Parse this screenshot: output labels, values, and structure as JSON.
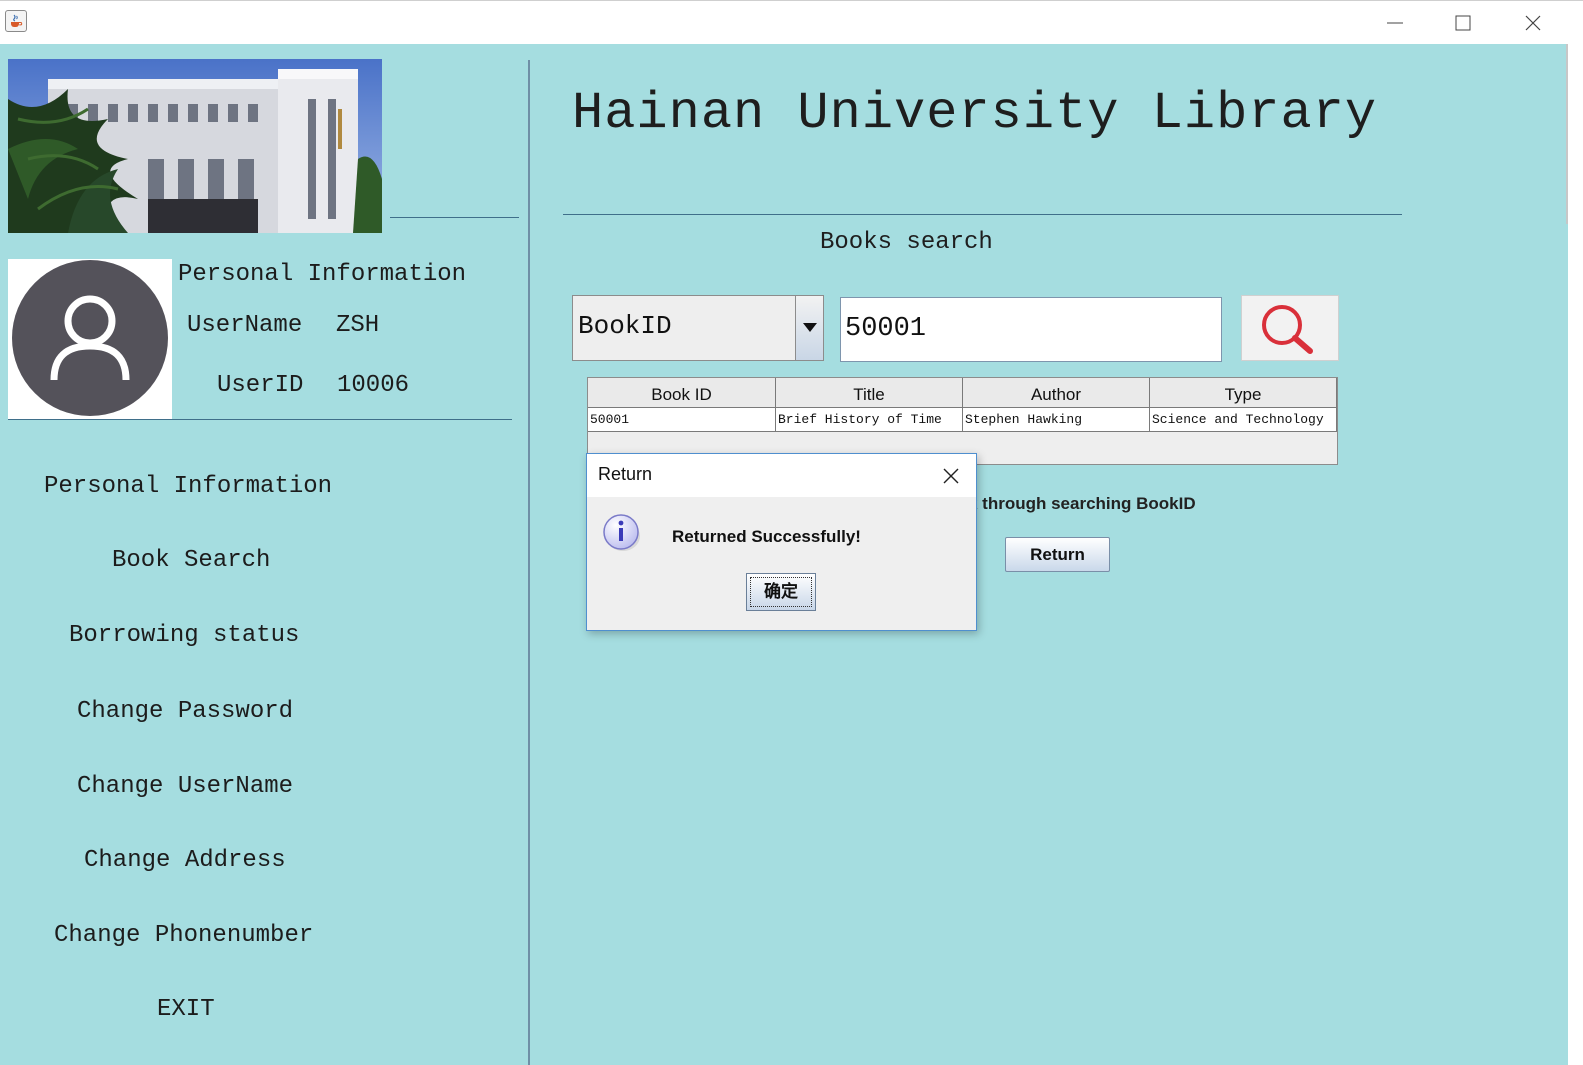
{
  "window": {
    "app_icon": "java-cup-icon",
    "controls": [
      "minimize-icon",
      "maximize-icon",
      "close-icon"
    ]
  },
  "sidebar": {
    "banner_image": "university-building-photo",
    "avatar_icon": "user-icon",
    "personal_heading": "Personal Information",
    "username_label": "UserName",
    "username_value": "ZSH",
    "userid_label": "UserID",
    "userid_value": "10006",
    "nav": [
      {
        "label": "Personal Information"
      },
      {
        "label": "Book Search"
      },
      {
        "label": "Borrowing status"
      },
      {
        "label": "Change Password"
      },
      {
        "label": "Change UserName"
      },
      {
        "label": "Change Address"
      },
      {
        "label": "Change Phonenumber"
      },
      {
        "label": "EXIT"
      }
    ]
  },
  "main": {
    "title": "Hainan University Library",
    "section_title": "Books search",
    "search": {
      "field_selected": "BookID",
      "query": "50001",
      "search_icon": "magnifier-icon"
    },
    "table": {
      "columns": [
        "Book ID",
        "Title",
        "Author",
        "Type"
      ],
      "rows": [
        [
          "50001",
          "Brief History of Time",
          "Stephen Hawking",
          "Science and Technology"
        ]
      ]
    },
    "hint_visible": "k through searching BookID",
    "return_button": "Return"
  },
  "dialog": {
    "title": "Return",
    "message": "Returned Successfully!",
    "ok_label": "确定",
    "icon": "info-icon"
  },
  "colors": {
    "background": "#a5dde0",
    "search_icon": "#d9303a",
    "avatar": "#54525a"
  }
}
